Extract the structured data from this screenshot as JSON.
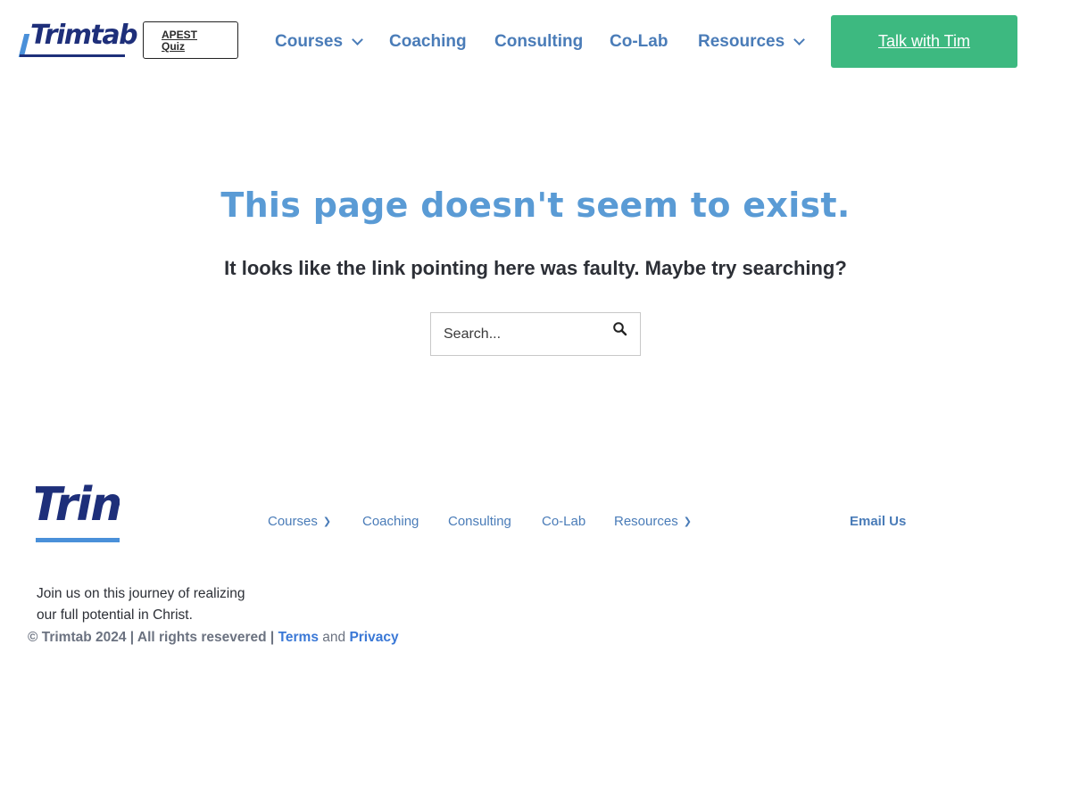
{
  "header": {
    "logo_text": "Trimtab",
    "quiz_label": "APEST Quiz",
    "nav": [
      {
        "label": "Courses"
      },
      {
        "label": "Coaching"
      },
      {
        "label": "Consulting"
      },
      {
        "label": "Co-Lab"
      },
      {
        "label": "Resources"
      }
    ],
    "cta_label": "Talk with Tim"
  },
  "main": {
    "headline": "This page doesn't seem to exist.",
    "subline": "It looks like the link pointing here was faulty. Maybe try searching?",
    "search_placeholder": "Search..."
  },
  "footer": {
    "logo_text": "Trimtab",
    "nav": [
      {
        "label": "Courses"
      },
      {
        "label": "Coaching"
      },
      {
        "label": "Consulting"
      },
      {
        "label": "Co-Lab"
      },
      {
        "label": "Resources"
      }
    ],
    "email_label": "Email Us",
    "tagline": "Join us on this journey of realizing our full potential in Christ.",
    "copyright": "© Trimtab 2024 | All rights resevered |",
    "terms_label": "Terms",
    "and_text": "and",
    "privacy_label": "Privacy"
  },
  "colors": {
    "brand_navy": "#1e2f7a",
    "brand_blue": "#5a9bd5",
    "nav_blue": "#4a7cb8",
    "cta_green": "#3db980"
  },
  "icons": [
    "chevron-down-icon",
    "search-icon"
  ]
}
